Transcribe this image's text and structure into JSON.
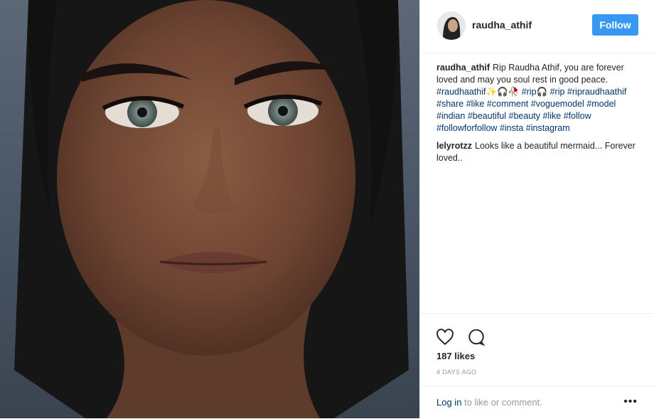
{
  "header": {
    "username": "raudha_athif",
    "follow_label": "Follow"
  },
  "caption": {
    "user": "raudha_athif",
    "text": "Rip Raudha Athif, you are forever loved and may you soul rest in good peace.",
    "tags": [
      "#raudhaathif✨🎧🥀",
      "#rip🎧",
      "#rip",
      "#ripraudhaathif",
      "#share",
      "#like",
      "#comment",
      "#voguemodel",
      "#model",
      "#indian",
      "#beautiful",
      "#beauty",
      "#like",
      "#follow",
      "#followforfollow",
      "#insta",
      "#instagram"
    ]
  },
  "comment": {
    "user": "lelyrotzz",
    "text": "Looks like a beautiful mermaid... Forever loved.."
  },
  "actions": {
    "heart_icon": "heart-outline-icon",
    "comment_icon": "comment-bubble-icon",
    "likes": "187 likes",
    "time": "4 DAYS AGO"
  },
  "footer": {
    "login_link": "Log in",
    "login_suffix": " to like or comment.",
    "more_label": "•••"
  },
  "colors": {
    "follow_button": "#3897f0",
    "link": "#003569",
    "text": "#262626",
    "muted": "#999999"
  }
}
